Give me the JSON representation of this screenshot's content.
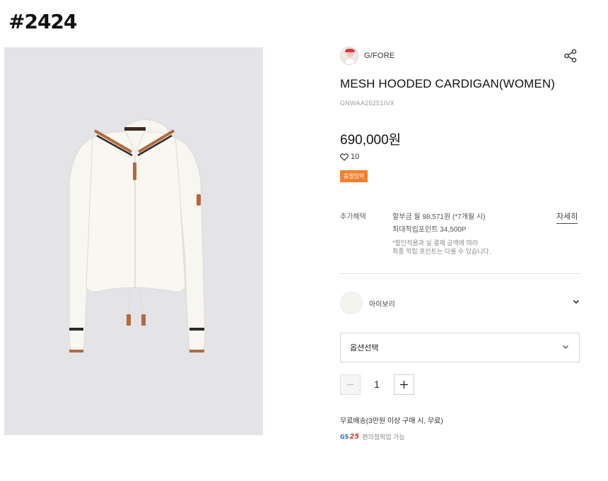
{
  "corner_tag": "#2424",
  "brand": {
    "name": "G/FORE",
    "logo_icon": "brand-avatar-icon"
  },
  "product": {
    "title": "MESH HOODED CARDIGAN(WOMEN)",
    "code": "GNWAA25251IVX",
    "price": "690,000원",
    "likes": "10",
    "badge": "품절임박"
  },
  "benefits": {
    "label": "추가혜택",
    "line1": "할부금 월 98,571원 (*7개월 시)",
    "line2": "최대적립포인트 34,500P",
    "note1": "*할인적용과 실 결제 금액에 따라",
    "note2": "최종 적립 포인트는 다를 수 있습니다.",
    "more": "자세히"
  },
  "color": {
    "name": "아이보리",
    "swatch": "#f4f3ee"
  },
  "option": {
    "label": "옵션선택"
  },
  "quantity": {
    "value": "1",
    "minus": "−",
    "plus": "+"
  },
  "shipping": {
    "text": "무료배송(3만원 이상 구매 시, 무료)"
  },
  "gs25": {
    "logo_gs": "GS",
    "logo_num": "25",
    "text": "편의점픽업 가능"
  },
  "colors": {
    "badge": "#f0812c",
    "image_bg": "#e4e3e8",
    "accent_brown": "#b5693a"
  }
}
